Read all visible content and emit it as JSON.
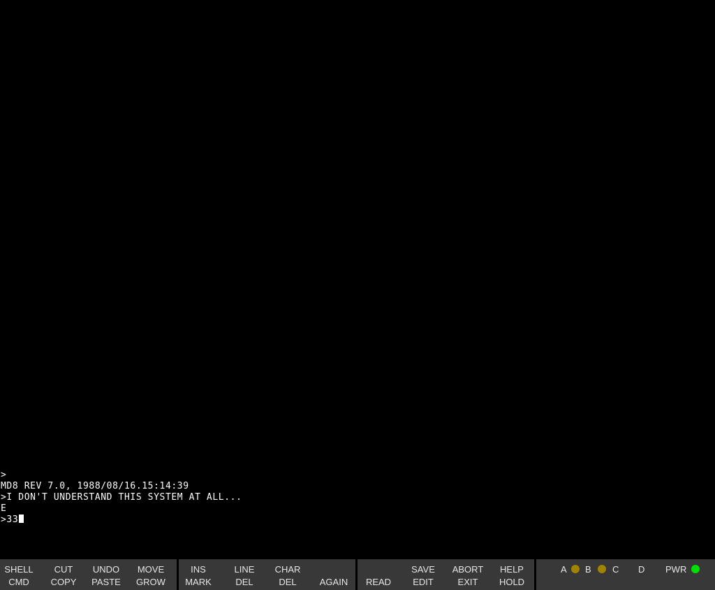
{
  "terminal": {
    "lines": [
      ">",
      "MD8 REV 7.0, 1988/08/16.15:14:39",
      ">I DON'T UNDERSTAND THIS SYSTEM AT ALL...",
      "E"
    ],
    "input_line": ">33"
  },
  "keyboard": {
    "group1": [
      {
        "top": "SHELL",
        "bottom": "CMD"
      },
      {
        "top": "CUT",
        "bottom": "COPY"
      },
      {
        "top": "UNDO",
        "bottom": "PASTE"
      },
      {
        "top": "MOVE",
        "bottom": "GROW"
      }
    ],
    "group2": [
      {
        "top": "INS",
        "bottom": "MARK"
      },
      {
        "top": "LINE",
        "bottom": "DEL"
      },
      {
        "top": "CHAR",
        "bottom": "DEL"
      },
      {
        "top": "",
        "bottom": "AGAIN"
      }
    ],
    "group3": [
      {
        "top": "",
        "bottom": "READ"
      },
      {
        "top": "SAVE",
        "bottom": "EDIT"
      },
      {
        "top": "ABORT",
        "bottom": "EXIT"
      },
      {
        "top": "HELP",
        "bottom": "HOLD"
      }
    ],
    "indicators": {
      "a": "A",
      "b": "B",
      "c": "C",
      "d": "D",
      "pwr": "PWR",
      "led_ab_color": "#a08400",
      "led_bc_color": "#a08400",
      "led_pwr_color": "#00e000"
    }
  }
}
